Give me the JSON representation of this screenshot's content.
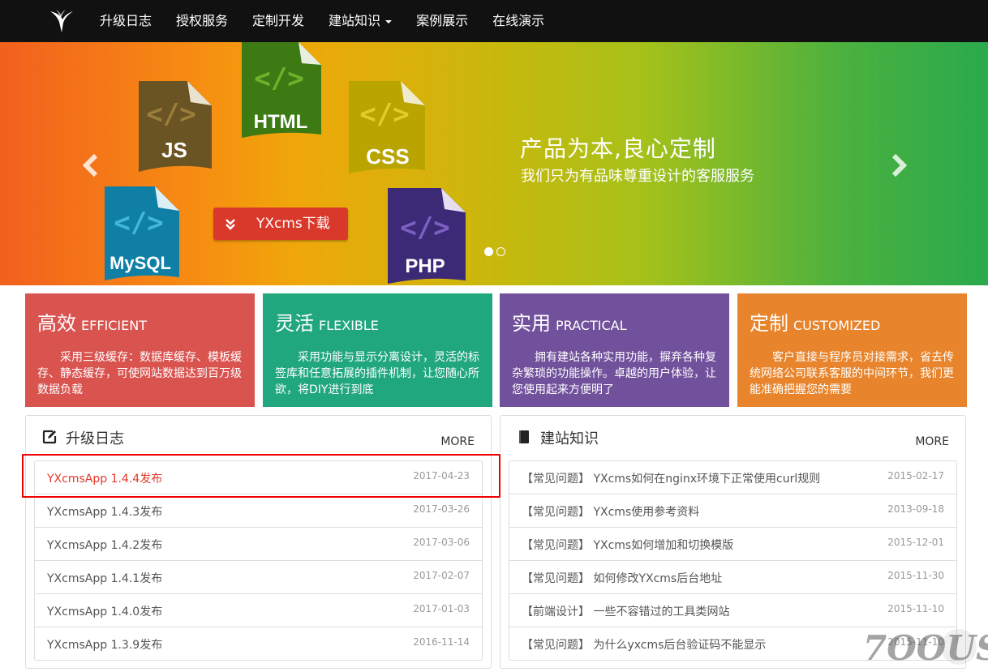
{
  "nav": {
    "items": [
      {
        "label": "升级日志"
      },
      {
        "label": "授权服务"
      },
      {
        "label": "定制开发"
      },
      {
        "label": "建站知识",
        "dropdown": true
      },
      {
        "label": "案例展示"
      },
      {
        "label": "在线演示"
      }
    ]
  },
  "hero": {
    "headline": "产品为本,良心定制",
    "subline": "我们只为有品味尊重设计的客服服务",
    "download_label": "YXcms下载",
    "files": [
      "JS",
      "HTML",
      "CSS",
      "MySQL",
      "PHP"
    ],
    "slide_count": 2,
    "active_slide": 1
  },
  "features": [
    {
      "title": "高效",
      "en": "EFFICIENT",
      "desc": "采用三级缓存：数据库缓存、模板缓存、静态缓存，可使网站数据达到百万级数据负载",
      "color": "#d9534f"
    },
    {
      "title": "灵活",
      "en": "FLEXIBLE",
      "desc": "采用功能与显示分离设计，灵活的标签库和任意拓展的插件机制，让您随心所欲，将DIY进行到底",
      "color": "#21a77d"
    },
    {
      "title": "实用",
      "en": "PRACTICAL",
      "desc": "拥有建站各种实用功能，摒弃各种复杂繁琐的功能操作。卓越的用户体验，让您使用起来方便明了",
      "color": "#71509c"
    },
    {
      "title": "定制",
      "en": "CUSTOMIZED",
      "desc": "客户直接与程序员对接需求，省去传统网络公司联系客服的中间环节，我们更能准确把握您的需要",
      "color": "#e8842b"
    }
  ],
  "changelog": {
    "title": "升级日志",
    "more": "MORE",
    "items": [
      {
        "name": "YXcmsApp 1.4.4发布",
        "date": "2017-04-23"
      },
      {
        "name": "YXcmsApp 1.4.3发布",
        "date": "2017-03-26"
      },
      {
        "name": "YXcmsApp 1.4.2发布",
        "date": "2017-03-06"
      },
      {
        "name": "YXcmsApp 1.4.1发布",
        "date": "2017-02-07"
      },
      {
        "name": "YXcmsApp 1.4.0发布",
        "date": "2017-01-03"
      },
      {
        "name": "YXcmsApp 1.3.9发布",
        "date": "2016-11-14"
      }
    ]
  },
  "knowledge": {
    "title": "建站知识",
    "more": "MORE",
    "items": [
      {
        "name": "【常见问题】 YXcms如何在nginx环境下正常使用curl规则",
        "date": "2015-02-17"
      },
      {
        "name": "【常见问题】 YXcms使用参考资料",
        "date": "2013-09-18"
      },
      {
        "name": "【常见问题】 YXcms如何增加和切换模版",
        "date": "2015-12-01"
      },
      {
        "name": "【常见问题】 如何修改YXcms后台地址",
        "date": "2015-11-30"
      },
      {
        "name": "【前端设计】 一些不容错过的工具类网站",
        "date": "2015-11-10"
      },
      {
        "name": "【常见问题】 为什么yxcms后台验证码不能显示",
        "date": "2015-11-10"
      }
    ]
  },
  "watermark": "7OOUS"
}
